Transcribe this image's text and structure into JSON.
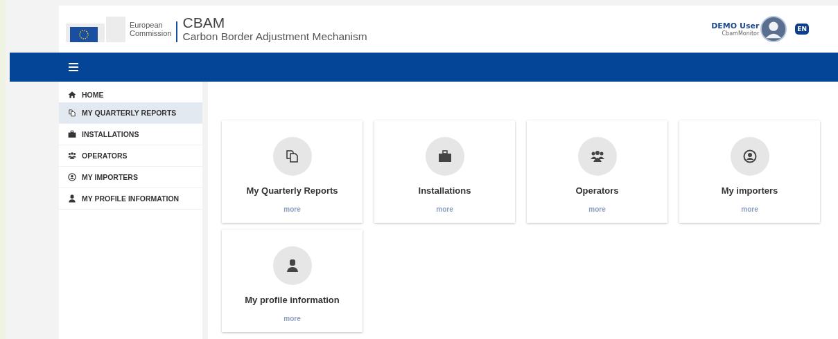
{
  "header": {
    "logo_line_1": "European",
    "logo_line_2": "Commission",
    "app_name": "CBAM",
    "app_subtitle": "Carbon Border Adjustment Mechanism",
    "user_name": "DEMO User",
    "user_role": "CbamMonitor",
    "language": "EN"
  },
  "sidebar": {
    "items": [
      {
        "label": "HOME",
        "selected": false
      },
      {
        "label": "MY QUARTERLY REPORTS",
        "selected": true
      },
      {
        "label": "INSTALLATIONS",
        "selected": false
      },
      {
        "label": "OPERATORS",
        "selected": false
      },
      {
        "label": "MY IMPORTERS",
        "selected": false
      },
      {
        "label": "MY PROFILE INFORMATION",
        "selected": false
      }
    ]
  },
  "cards": [
    {
      "title": "My Quarterly Reports",
      "link": "more"
    },
    {
      "title": "Installations",
      "link": "more"
    },
    {
      "title": "Operators",
      "link": "more"
    },
    {
      "title": "My importers",
      "link": "more"
    },
    {
      "title": "My profile information",
      "link": "more"
    }
  ]
}
